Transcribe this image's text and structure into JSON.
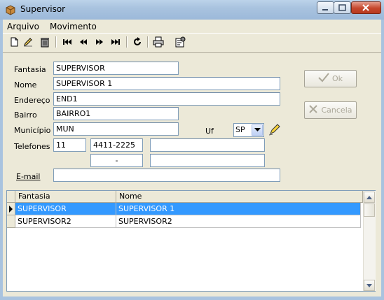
{
  "window": {
    "title": "Supervisor"
  },
  "menu": {
    "items": [
      "Arquivo",
      "Movimento"
    ]
  },
  "toolbar": {
    "icons": [
      "new-document",
      "edit-pencil",
      "delete-trash",
      "first-record",
      "previous-record",
      "next-record",
      "last-record",
      "refresh",
      "print",
      "properties"
    ]
  },
  "form": {
    "fantasia": {
      "label": "Fantasia",
      "value": "SUPERVISOR"
    },
    "nome": {
      "label": "Nome",
      "value": "SUPERVISOR 1"
    },
    "endereco": {
      "label": "Endereço",
      "value": "END1"
    },
    "bairro": {
      "label": "Bairro",
      "value": "BAIRRO1"
    },
    "municipio": {
      "label": "Município",
      "value": "MUN"
    },
    "uf": {
      "label": "Uf",
      "value": "SP"
    },
    "telefones": {
      "label": "Telefones",
      "ddd1": "11",
      "numero1": "4411-2225",
      "extra1": "",
      "ddd2": "",
      "numero2": "-",
      "extra2": ""
    },
    "email": {
      "label": "E-mail",
      "value": ""
    }
  },
  "buttons": {
    "ok": "Ok",
    "cancel": "Cancela"
  },
  "grid": {
    "columns": [
      "Fantasia",
      "Nome"
    ],
    "rows": [
      {
        "fantasia": "SUPERVISOR",
        "nome": "SUPERVISOR 1",
        "selected": true
      },
      {
        "fantasia": "SUPERVISOR2",
        "nome": "SUPERVISOR2",
        "selected": false
      }
    ]
  },
  "colors": {
    "selection": "#3399ff",
    "disabled_text": "#aca899"
  }
}
